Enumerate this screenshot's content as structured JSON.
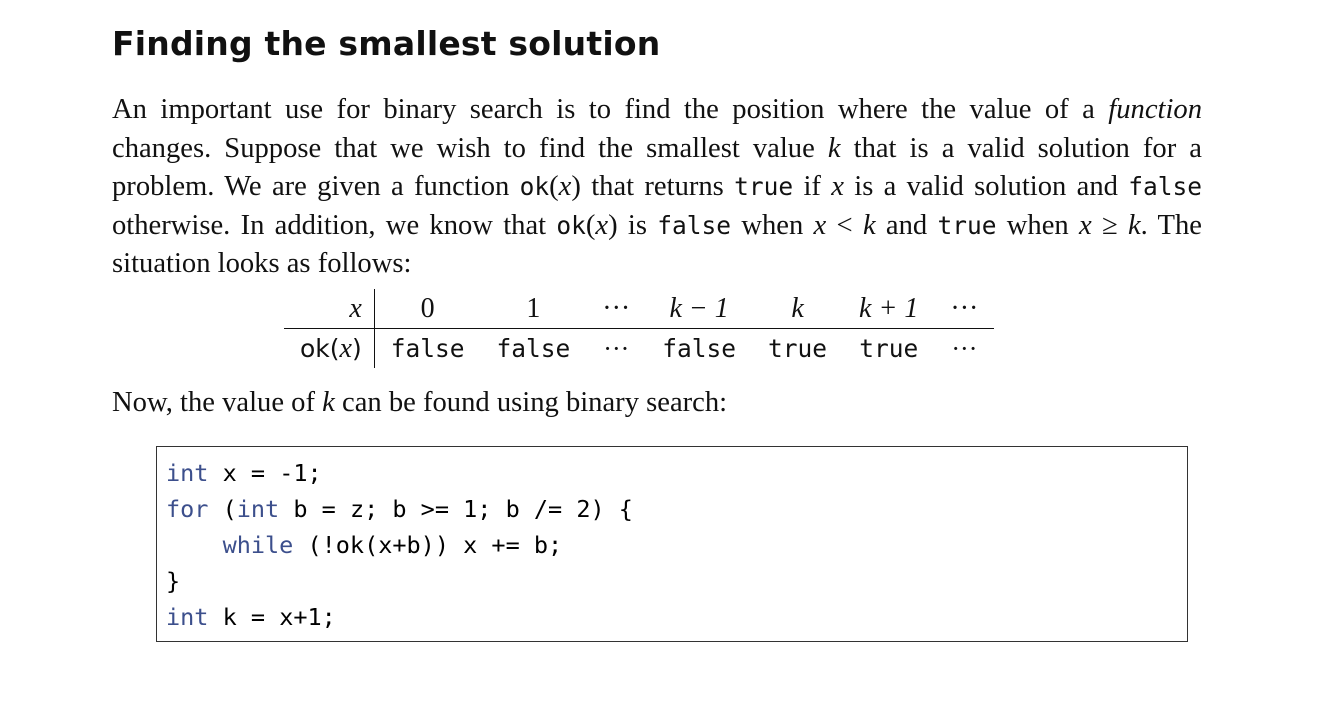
{
  "title": "Finding the smallest solution",
  "paragraph": {
    "s1": "An important use for binary search is to find the position where the value of a ",
    "s2_em": "function",
    "s3": " changes. Suppose that we wish to find the smallest value ",
    "k1": "k",
    "s4": " that is a valid solution for a problem. We are given a function ",
    "ok1": "ok",
    "x1": "x",
    "s5": " that returns ",
    "true1": "true",
    "s6": " if ",
    "x2": "x",
    "s7": " is a valid solution and ",
    "false1": "false",
    "s8": " otherwise. In addition, we know that ",
    "ok2": "ok",
    "x3": "x",
    "s9": " is ",
    "false2": "false",
    "s10": " when ",
    "x4": "x",
    "lt": "<",
    "k2": "k",
    "s11": " and ",
    "true2": "true",
    "s12": " when ",
    "x5": "x",
    "ge": "≥",
    "k3": "k",
    "s13": ". The situation looks as follows:"
  },
  "table": {
    "row1_label": "x",
    "row2_label_fn": "ok",
    "row2_label_arg": "x",
    "headers": [
      "0",
      "1",
      "···",
      "k − 1",
      "k",
      "k + 1",
      "···"
    ],
    "values": [
      "false",
      "false",
      "···",
      "false",
      "true",
      "true",
      "···"
    ]
  },
  "paragraph2": {
    "s1": "Now, the value of ",
    "k": "k",
    "s2": " can be found using binary search:"
  },
  "code": {
    "l1_kw": "int",
    "l1_rest": " x = -1;",
    "l2_kw1": "for",
    "l2_p": " (",
    "l2_kw2": "int",
    "l2_rest": " b = z; b >= 1; b /= 2) {",
    "l3_indent": "    ",
    "l3_kw": "while",
    "l3_rest": " (!ok(x+b)) x += b;",
    "l4": "}",
    "l5_kw": "int",
    "l5_rest": " k = x+1;"
  }
}
